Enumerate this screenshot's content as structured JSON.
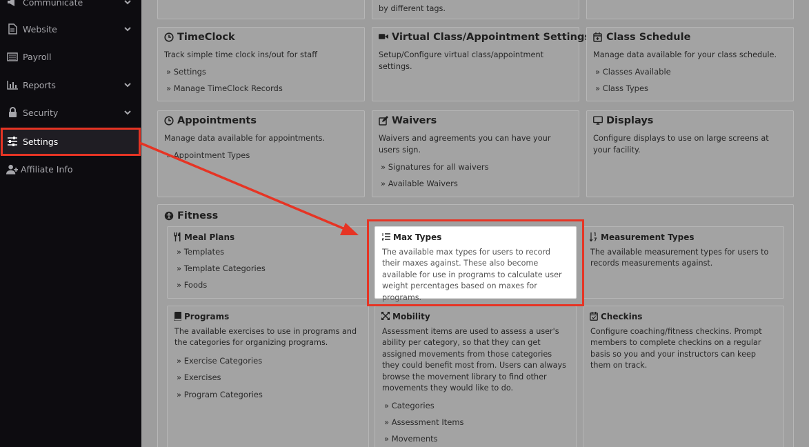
{
  "sidebar": {
    "items": [
      {
        "label": "Communicate",
        "icon": "megaphone-icon",
        "chevron": true
      },
      {
        "label": "Website",
        "icon": "document-icon",
        "chevron": true
      },
      {
        "label": "Payroll",
        "icon": "list-icon",
        "chevron": false
      },
      {
        "label": "Reports",
        "icon": "bar-chart-icon",
        "chevron": true
      },
      {
        "label": "Security",
        "icon": "lock-icon",
        "chevron": true
      },
      {
        "label": "Settings",
        "icon": "sliders-icon",
        "chevron": false
      },
      {
        "label": "Affiliate Info",
        "icon": "user-plus-icon",
        "chevron": false
      }
    ]
  },
  "top_partial": {
    "middle_desc": "by different tags."
  },
  "cards": {
    "timeclock": {
      "title": "TimeClock",
      "desc": "Track simple time clock ins/out for staff",
      "links": [
        "Settings",
        "Manage TimeClock Records"
      ]
    },
    "virtual": {
      "title": "Virtual Class/Appointment Settings",
      "desc": "Setup/Configure virtual class/appointment settings."
    },
    "schedule": {
      "title": "Class Schedule",
      "desc": "Manage data available for your class schedule.",
      "links": [
        "Classes Available",
        "Class Types"
      ]
    },
    "appointments": {
      "title": "Appointments",
      "desc": "Manage data available for appointments.",
      "links": [
        "Appointment Types"
      ]
    },
    "waivers": {
      "title": "Waivers",
      "desc": "Waivers and agreements you can have your users sign.",
      "links": [
        "Signatures for all waivers",
        "Available Waivers"
      ]
    },
    "displays": {
      "title": "Displays",
      "desc": "Configure displays to use on large screens at your facility."
    }
  },
  "fitness": {
    "title": "Fitness",
    "meal": {
      "title": "Meal Plans",
      "links": [
        "Templates",
        "Template Categories",
        "Foods"
      ]
    },
    "max": {
      "title": "Max Types",
      "desc": "The available max types for users to record their maxes against. These also become available for use in programs to calculate user weight percentages based on maxes for programs."
    },
    "measurement": {
      "title": "Measurement Types",
      "desc": "The available measurement types for users to records measurements against."
    },
    "programs": {
      "title": "Programs",
      "desc": "The available exercises to use in programs and the categories for organizing programs.",
      "links": [
        "Exercise Categories",
        "Exercises",
        "Program Categories"
      ]
    },
    "mobility": {
      "title": "Mobility",
      "desc": "Assessment items are used to assess a user's ability per category, so that they can get assigned movements from those categories they could benefit most from. Users can always browse the movement library to find other movements they would like to do.",
      "links": [
        "Categories",
        "Assessment Items",
        "Movements"
      ]
    },
    "checkins": {
      "title": "Checkins",
      "desc": "Configure coaching/fitness checkins. Prompt members to complete checkins on a regular basis so you and your instructors can keep them on track."
    }
  },
  "colors": {
    "highlight": "#e63424",
    "sidebar_bg": "#0d0c10",
    "overlay_bg": "#9d9d9d"
  }
}
